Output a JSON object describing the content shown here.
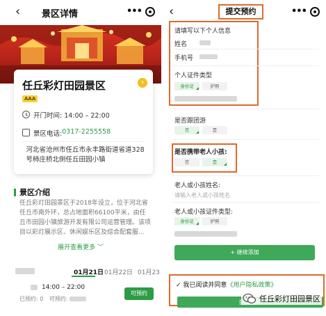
{
  "left": {
    "nav": {
      "back": "‹",
      "title": "景区详情",
      "more": "•••"
    },
    "scenic": {
      "name": "任丘彩灯田园景区",
      "rating": "AAA",
      "hours": "开门时间: 14:00 – 22:00",
      "phone_label": "景区电话: ",
      "phone": "0317-2255558",
      "address": "河北省沧州市任丘市永丰路街道省道328号柿庄桥北侧任丘田园小镇"
    },
    "intro": {
      "title": "景区介绍",
      "text": "任丘彩灯田园景区于2018年设立，位于河北省任丘市南外环，总占地面积66100平米，由任丘市田园小镇旅游开发有限公司运营管理。该项目以彩灯展示区、休闲娱乐区及综合配套服...",
      "expand": "展开查看更多 ﹀"
    },
    "dates": [
      "01月21日",
      "01月22日",
      "01月23"
    ],
    "slot": {
      "time": "14:00 – 22:00",
      "booked_prefix": "已预约: ",
      "booked_value": "0",
      "left_prefix": "可预约: ",
      "reserve": "可预约"
    }
  },
  "right": {
    "nav": {
      "back": "‹",
      "title": "提交预约",
      "more": "•••"
    },
    "form": {
      "header": "请填写以下个人信息",
      "name_label": "姓名",
      "phone_label": "手机号",
      "id_type_label": "个人证件类型",
      "id_options": [
        "身份证",
        "护照"
      ],
      "group_label": "是否跟团游",
      "group_options": [
        "否",
        "是"
      ],
      "elder_label": "是否携带老人小孩:",
      "elder_options": [
        "否",
        "是"
      ],
      "elder_name_label": "老人或小孩姓名:",
      "elder_name_placeholder": "请输入老人或小孩姓名",
      "elder_id_label": "老人或小孩证件类型:",
      "elder_id_options": [
        "身份证",
        "护照"
      ],
      "add_button": "+ 继续添加"
    },
    "agree": {
      "check": "✓",
      "text": "我已阅读并同意",
      "policy": "《用户隐私政策》"
    },
    "submit": "提交预约"
  },
  "watermark": "任丘彩灯田园景区"
}
